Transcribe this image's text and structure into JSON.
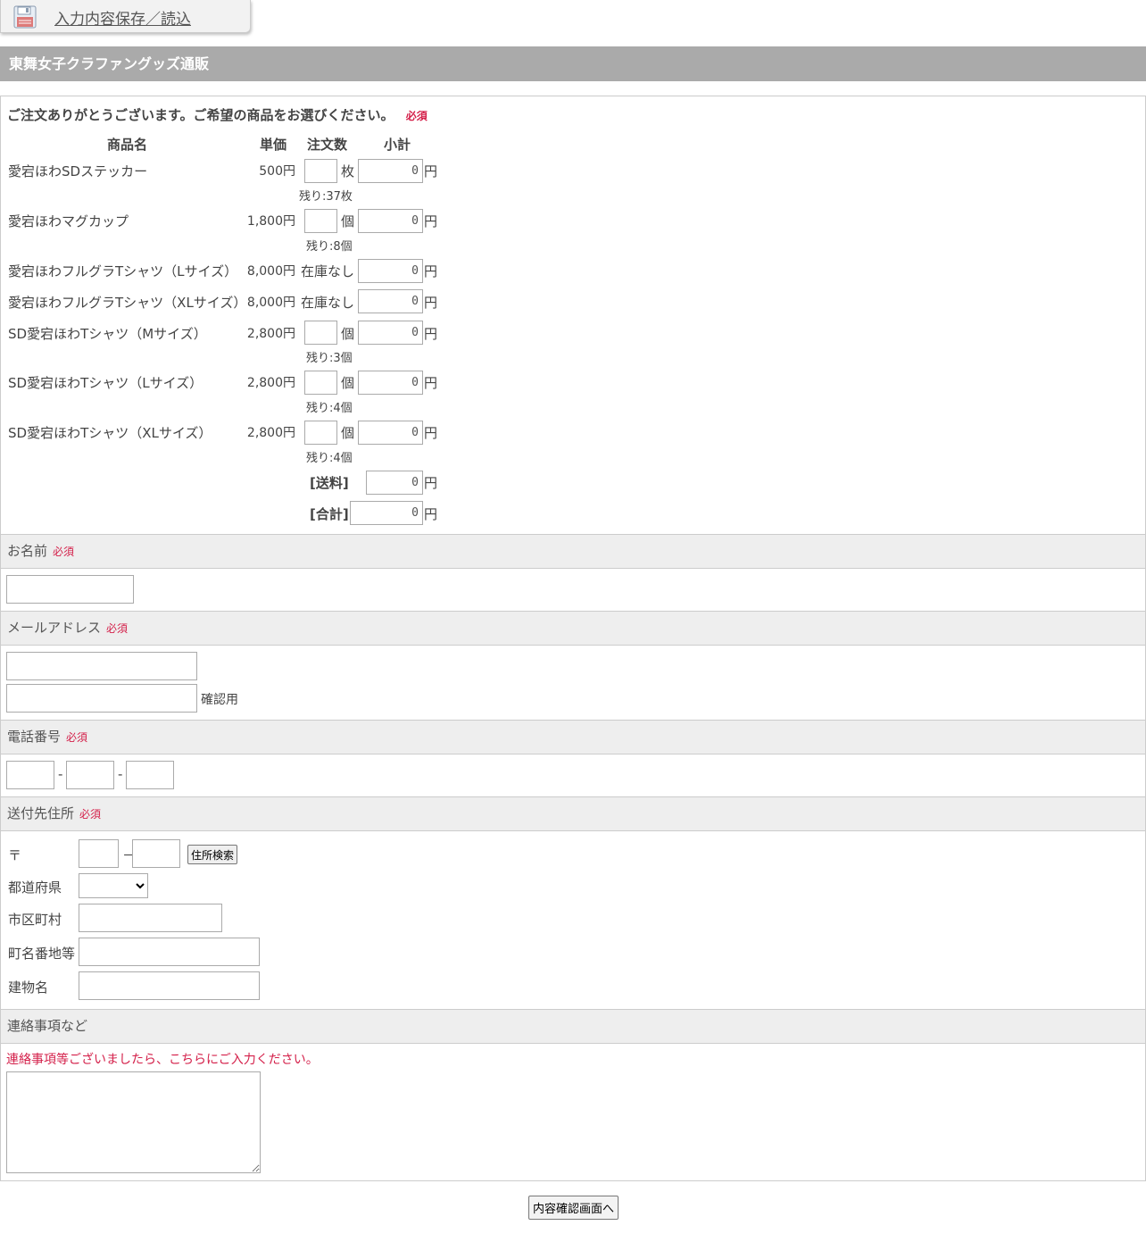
{
  "save_tab": {
    "label": "入力内容保存／読込"
  },
  "title": "東舞女子クラファングッズ通販",
  "order": {
    "intro": "ご注文ありがとうございます。ご希望の商品をお選びください。",
    "required": "必須",
    "headers": {
      "name": "商品名",
      "price": "単価",
      "qty": "注文数",
      "subtotal": "小計"
    },
    "yen": "円",
    "items": [
      {
        "name": "愛宕ほわSDステッカー",
        "price": "500円",
        "unit": "枚",
        "remaining": "残り:37枚",
        "subtotal": "0",
        "in_stock": true
      },
      {
        "name": "愛宕ほわマグカップ",
        "price": "1,800円",
        "unit": "個",
        "remaining": "残り:8個",
        "subtotal": "0",
        "in_stock": true
      },
      {
        "name": "愛宕ほわフルグラTシャツ（Lサイズ）",
        "price": "8,000円",
        "stock_text": "在庫なし",
        "subtotal": "0",
        "in_stock": false
      },
      {
        "name": "愛宕ほわフルグラTシャツ（XLサイズ）",
        "price": "8,000円",
        "stock_text": "在庫なし",
        "subtotal": "0",
        "in_stock": false
      },
      {
        "name": "SD愛宕ほわTシャツ（Mサイズ）",
        "price": "2,800円",
        "unit": "個",
        "remaining": "残り:3個",
        "subtotal": "0",
        "in_stock": true
      },
      {
        "name": "SD愛宕ほわTシャツ（Lサイズ）",
        "price": "2,800円",
        "unit": "個",
        "remaining": "残り:4個",
        "subtotal": "0",
        "in_stock": true
      },
      {
        "name": "SD愛宕ほわTシャツ（XLサイズ）",
        "price": "2,800円",
        "unit": "個",
        "remaining": "残り:4個",
        "subtotal": "0",
        "in_stock": true
      }
    ],
    "shipping_label": "[送料]",
    "shipping_value": "0",
    "total_label": "[合計]",
    "total_value": "0"
  },
  "name_section": {
    "label": "お名前",
    "required": "必須"
  },
  "email_section": {
    "label": "メールアドレス",
    "required": "必須",
    "confirm_label": "確認用"
  },
  "phone_section": {
    "label": "電話番号",
    "required": "必須",
    "separator": "-"
  },
  "address_section": {
    "label": "送付先住所",
    "required": "必須",
    "postal_mark": "〒",
    "postal_separator": "－",
    "search_button": "住所検索",
    "prefecture_label": "都道府県",
    "city_label": "市区町村",
    "street_label": "町名番地等",
    "building_label": "建物名"
  },
  "notes_section": {
    "label": "連絡事項など",
    "note": "連絡事項等ございましたら、こちらにご入力ください。"
  },
  "submit_button": "内容確認画面へ",
  "colors": {
    "required": "#d4204a",
    "title_bar": "#aaaaaa",
    "section_bg": "#eeeeee"
  },
  "icons": {
    "save": "floppy-disk-icon"
  }
}
